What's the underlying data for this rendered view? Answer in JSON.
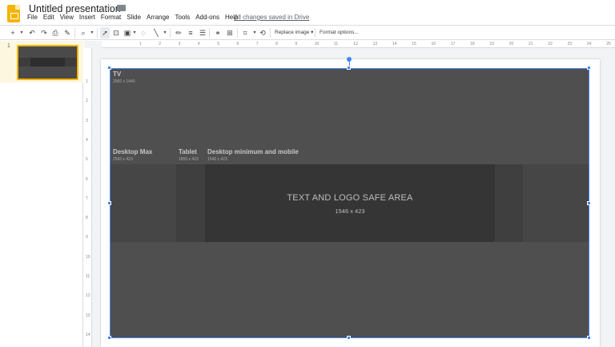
{
  "header": {
    "title": "Untitled presentation",
    "star_icon": "star-icon",
    "folder_icon": "folder-icon",
    "menu": [
      "File",
      "Edit",
      "View",
      "Insert",
      "Format",
      "Slide",
      "Arrange",
      "Tools",
      "Add-ons",
      "Help"
    ],
    "saved_status": "All changes saved in Drive"
  },
  "toolbar": {
    "replace_image_label": "Replace image",
    "format_options_label": "Format options..."
  },
  "filmstrip": {
    "slides": [
      {
        "number": "1"
      }
    ]
  },
  "ruler": {
    "top": [
      "1",
      "2",
      "3",
      "4",
      "5",
      "6",
      "7",
      "8",
      "9",
      "10",
      "11",
      "12",
      "13",
      "14",
      "15",
      "16",
      "17",
      "18",
      "19",
      "20",
      "21",
      "22",
      "23",
      "24",
      "25"
    ],
    "left": [
      "1",
      "2",
      "3",
      "4",
      "5",
      "6",
      "7",
      "8",
      "9",
      "10",
      "11",
      "12",
      "13",
      "14"
    ]
  },
  "image": {
    "tv_label": "TV",
    "tv_dim": "2560 x 1440",
    "desktop_max_label": "Desktop Max",
    "desktop_max_dim": "2560 x 423",
    "tablet_label": "Tablet",
    "tablet_dim": "1855 x 423",
    "desktop_min_label": "Desktop minimum and mobile",
    "desktop_min_dim": "1546 x 423",
    "safe_area_label": "TEXT AND LOGO SAFE AREA",
    "safe_area_dim": "1546 x 423"
  },
  "colors": {
    "accent": "#f4b400",
    "selection": "#4285f4",
    "image_bg": "#4f4f4f"
  }
}
